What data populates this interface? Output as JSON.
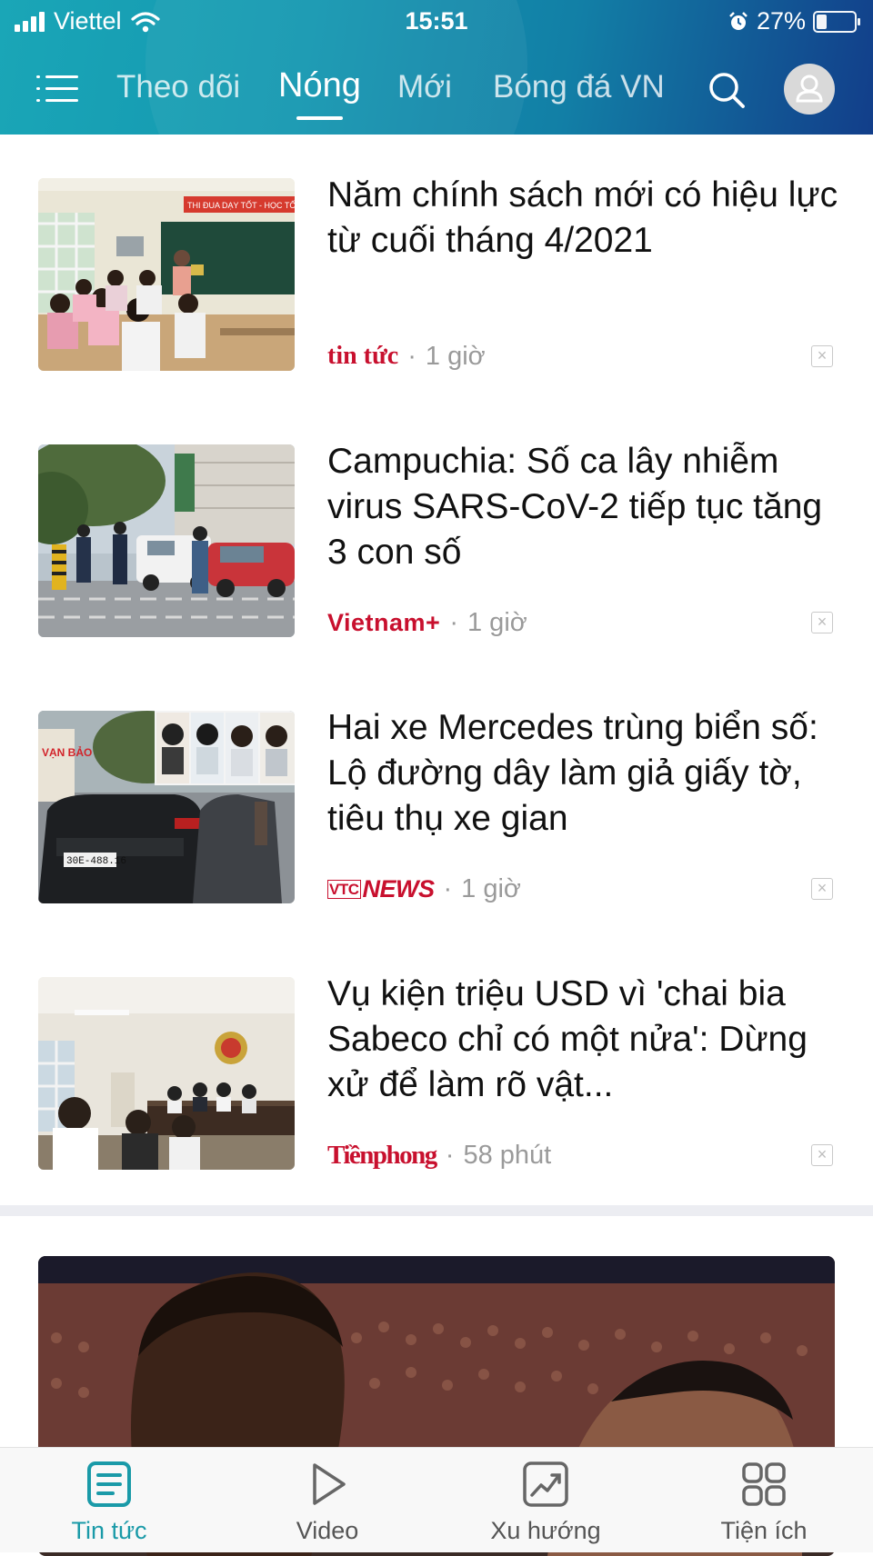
{
  "status_bar": {
    "carrier": "Viettel",
    "time": "15:51",
    "battery": "27%",
    "battery_level": 0.27
  },
  "header": {
    "tabs": [
      {
        "label": "Theo dõi",
        "active": false
      },
      {
        "label": "Nóng",
        "active": true
      },
      {
        "label": "Mới",
        "active": false
      },
      {
        "label": "Bóng đá VN",
        "active": false
      }
    ],
    "accent": "#1497b0"
  },
  "articles": [
    {
      "title": "Năm chính sách mới có hiệu lực từ cuối tháng 4/2021",
      "source": "tin tức",
      "time": "1 giờ"
    },
    {
      "title": "Campuchia: Số ca lây nhiễm virus SARS-CoV-2 tiếp tục tăng 3 con số",
      "source": "Vietnam+",
      "time": "1 giờ"
    },
    {
      "title": "Hai xe Mercedes trùng biển số: Lộ đường dây làm giả giấy tờ, tiêu thụ xe gian",
      "source_prefix": "VTC",
      "source": "NEWS",
      "time": "1 giờ"
    },
    {
      "title": "Vụ kiện triệu USD vì 'chai bia Sabeco chỉ có một nửa': Dừng xử để làm rõ vật...",
      "source": "Tiềnphong",
      "time": "58 phút"
    }
  ],
  "meta_separator": "·",
  "dismiss_glyph": "×",
  "thumbnail_text": {
    "classroom_banner": "THI ĐUA DẠY TỐT - HỌC TỐT",
    "plate": "30E-488.16",
    "sign": "VẠN BẢO"
  },
  "bottom_nav": [
    {
      "label": "Tin tức",
      "icon": "news-icon",
      "active": true
    },
    {
      "label": "Video",
      "icon": "play-icon",
      "active": false
    },
    {
      "label": "Xu hướng",
      "icon": "trending-icon",
      "active": false
    },
    {
      "label": "Tiện ích",
      "icon": "grid-icon",
      "active": false
    }
  ],
  "colors": {
    "active_tab": "#1a9aa8",
    "source_red": "#c8102e"
  }
}
